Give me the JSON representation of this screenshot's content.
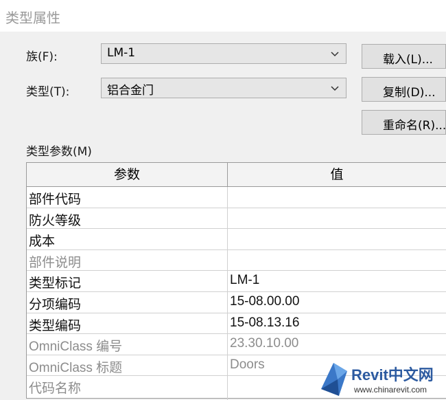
{
  "dialog": {
    "title": "类型属性"
  },
  "family": {
    "label": "族(F):",
    "value": "LM-1"
  },
  "type": {
    "label": "类型(T):",
    "value": "铝合金门"
  },
  "buttons": {
    "load": "载入(L)...",
    "duplicate": "复制(D)...",
    "rename": "重命名(R)..."
  },
  "type_params_label": "类型参数(M)",
  "table": {
    "headers": {
      "param": "参数",
      "value": "值"
    },
    "rows": [
      {
        "param": "部件代码",
        "value": ""
      },
      {
        "param": "防火等级",
        "value": ""
      },
      {
        "param": "成本",
        "value": ""
      },
      {
        "param": "部件说明",
        "value": ""
      },
      {
        "param": "类型标记",
        "value": "LM-1"
      },
      {
        "param": "分项编码",
        "value": "15-08.00.00"
      },
      {
        "param": "类型编码",
        "value": "15-08.13.16"
      },
      {
        "param": "OmniClass 编号",
        "value": "23.30.10.00"
      },
      {
        "param": "OmniClass 标题",
        "value": "Doors"
      },
      {
        "param": "代码名称",
        "value": ""
      }
    ]
  },
  "watermark": {
    "brand": "Revit中文网",
    "url": "www.chinarevit.com"
  },
  "colors": {
    "accent": "#2c5aa0",
    "dimmed_text": "#8c8c8c"
  }
}
